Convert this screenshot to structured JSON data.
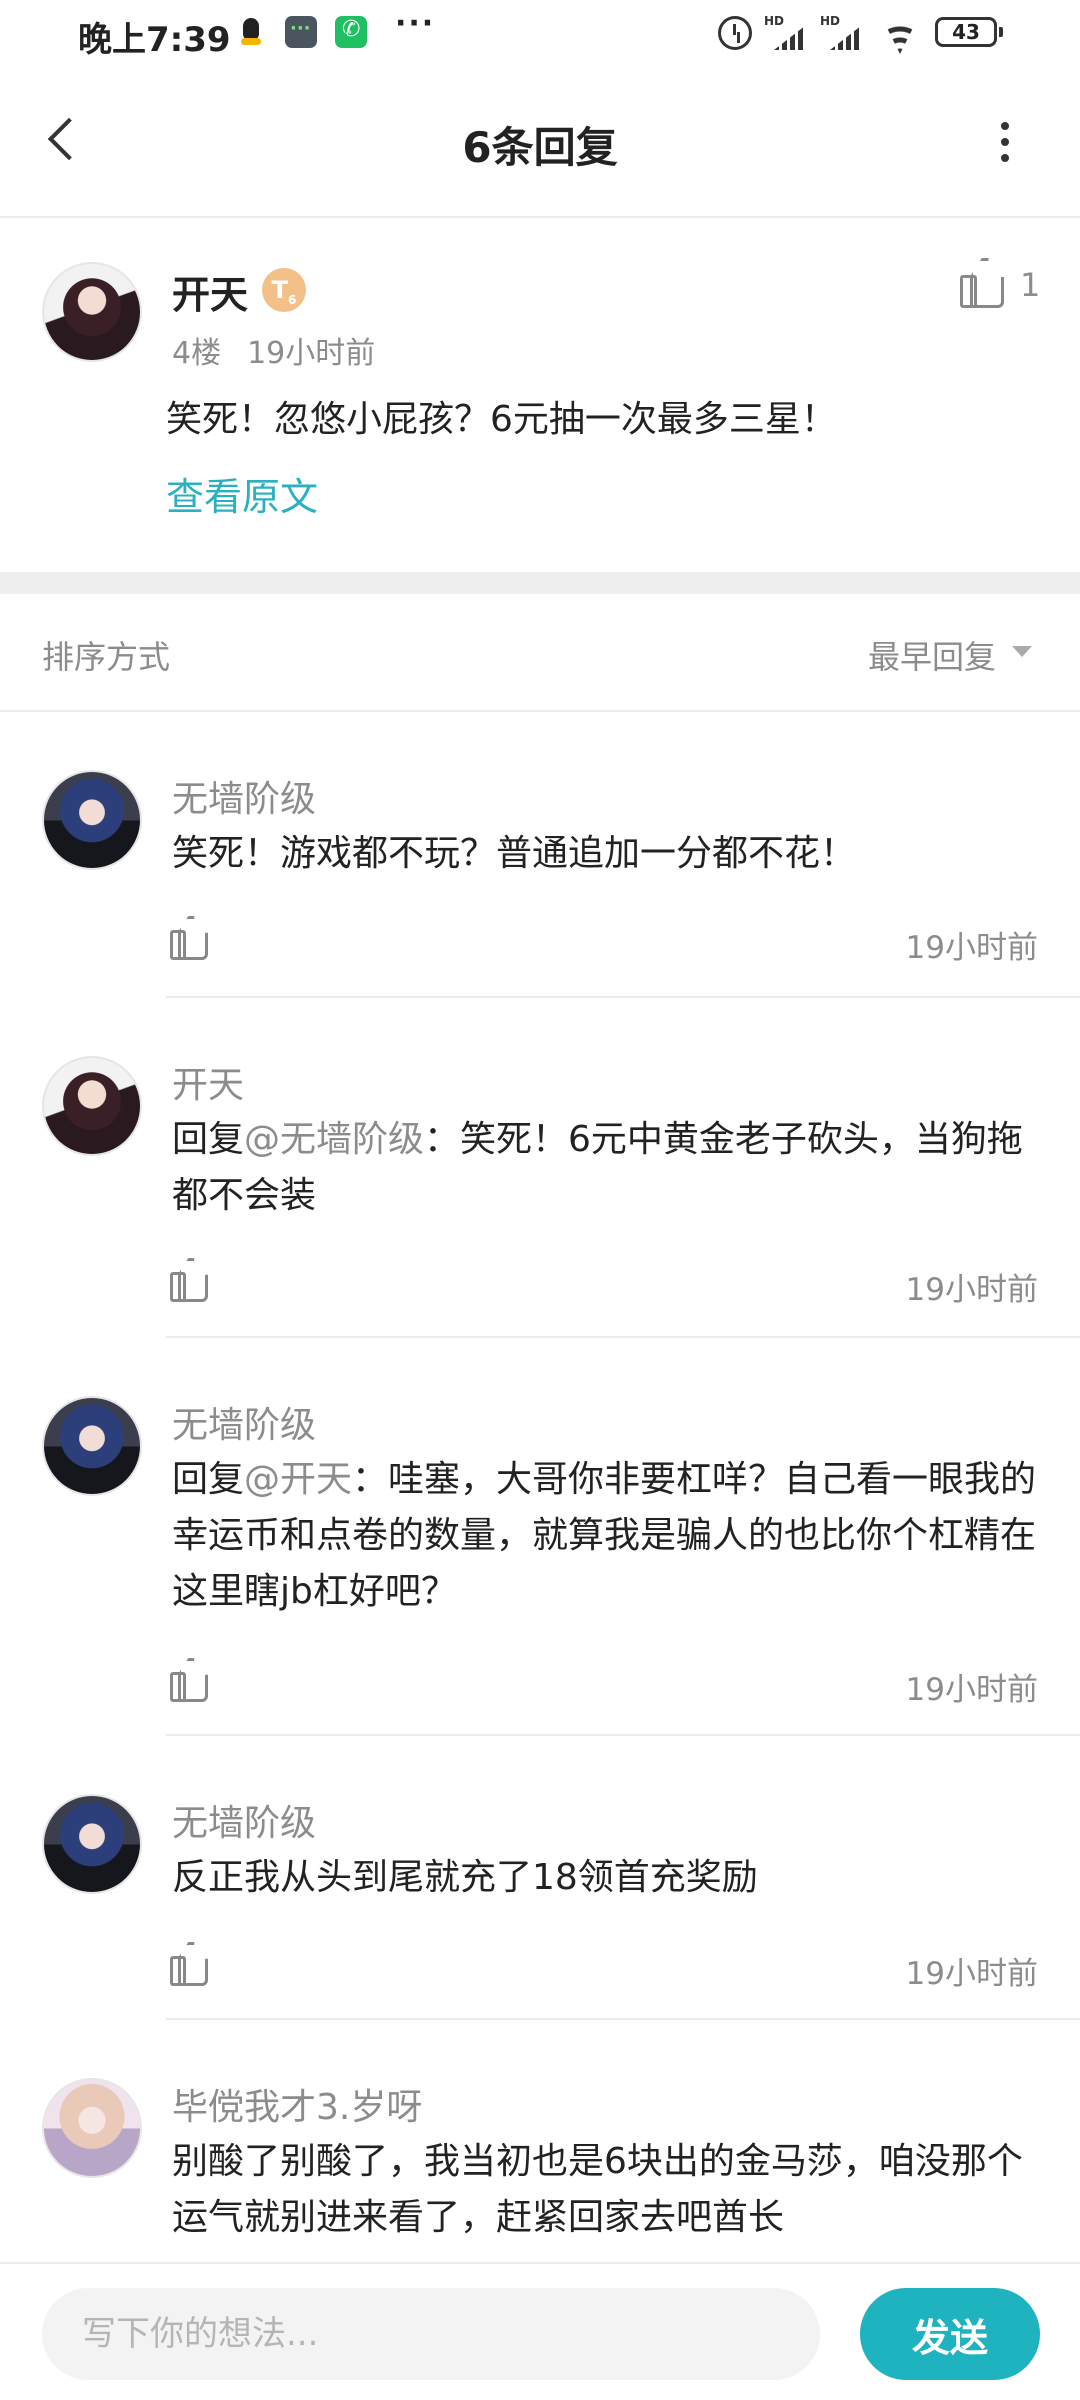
{
  "status_bar": {
    "time": "晚上7:39",
    "more": "···",
    "signal_label_1": "HD",
    "signal_label_2": "HD",
    "battery": "43"
  },
  "header": {
    "title": "6条回复"
  },
  "original_comment": {
    "author": "开天",
    "level_badge": "T",
    "level_badge_sub": "6",
    "floor": "4楼",
    "time": "19小时前",
    "text": "笑死！忽悠小屁孩？6元抽一次最多三星！",
    "view_original": "查看原文",
    "like_count": "1"
  },
  "sort": {
    "label": "排序方式",
    "selected": "最早回复"
  },
  "replies": [
    {
      "author": "无墙阶级",
      "prefix": "",
      "mention": "",
      "text": "笑死！游戏都不玩？普通追加一分都不花！",
      "time": "19小时前"
    },
    {
      "author": "开天",
      "prefix": "回复",
      "mention": "@无墙阶级",
      "text": "：笑死！6元中黄金老子砍头，当狗拖都不会装",
      "time": "19小时前"
    },
    {
      "author": "无墙阶级",
      "prefix": "回复",
      "mention": "@开天",
      "text": "：哇塞，大哥你非要杠咩？自己看一眼我的幸运币和点卷的数量，就算我是骗人的也比你个杠精在这里瞎jb杠好吧？",
      "time": "19小时前"
    },
    {
      "author": "无墙阶级",
      "prefix": "",
      "mention": "",
      "text": "反正我从头到尾就充了18领首充奖励",
      "time": "19小时前"
    },
    {
      "author": "毕傥我才3.岁呀",
      "prefix": "",
      "mention": "",
      "text": "别酸了别酸了，我当初也是6块出的金马莎，咱没那个运气就别进来看了，赶紧回家去吧酋长",
      "time": ""
    }
  ],
  "bottom_bar": {
    "input_placeholder": "写下你的想法...",
    "send_label": "发送"
  }
}
